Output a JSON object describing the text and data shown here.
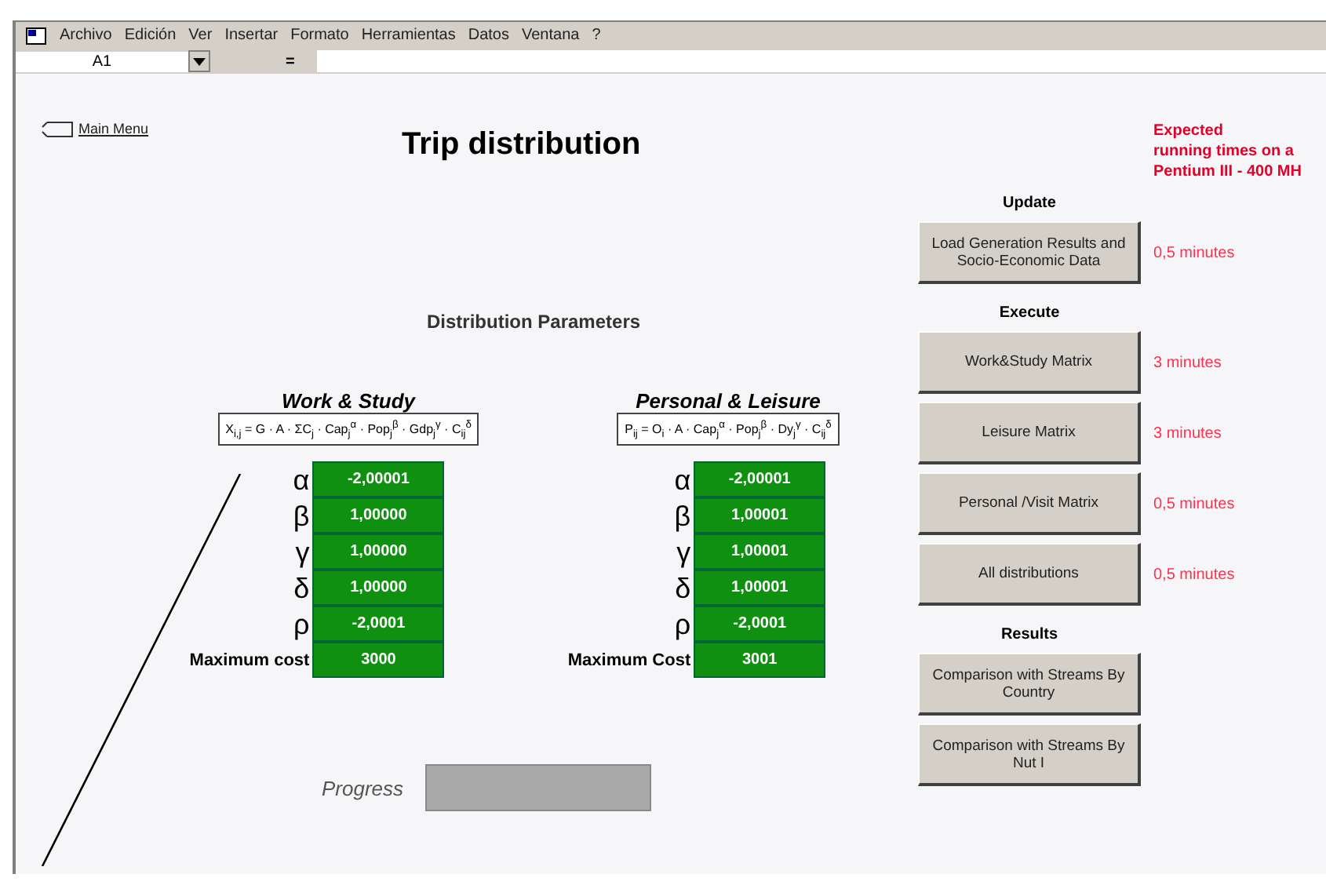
{
  "menu_bar": {
    "items": [
      "Archivo",
      "Edición",
      "Ver",
      "Insertar",
      "Formato",
      "Herramientas",
      "Datos",
      "Ventana",
      "?"
    ]
  },
  "formula_bar": {
    "cell_reference": "A1",
    "equals": "="
  },
  "main_menu_link": "Main Menu",
  "title": "Trip distribution",
  "parameters_heading": "Distribution Parameters",
  "parameter_sets": [
    {
      "title": "Work & Study",
      "formula": "X$_{i,j}$ = G · A · ΣC$_{j}$ · Cap$_{j}$$^{α}$ · Pop$_{j}$$^{β}$ · Gdp$_{j}$$^{γ}$ · C$_{ij}$$^{δ}$",
      "rows": [
        {
          "label": "α",
          "value": "-2,00001",
          "kind": "greek"
        },
        {
          "label": "β",
          "value": "1,00000",
          "kind": "greek"
        },
        {
          "label": "γ",
          "value": "1,00000",
          "kind": "greek"
        },
        {
          "label": "δ",
          "value": "1,00000",
          "kind": "greek"
        },
        {
          "label": "ρ",
          "value": "-2,0001",
          "kind": "greek"
        },
        {
          "label": "Maximum cost",
          "value": "3000",
          "kind": "text"
        }
      ]
    },
    {
      "title": "Personal & Leisure",
      "formula": "P$_{ij}$ = O$_{i}$ · A · Cap$_{j}$$^{α}$ · Pop$_{j}$$^{β}$ · Dy$_{j}$$^{γ}$ · C$_{ij}$$^{δ}$",
      "rows": [
        {
          "label": "α",
          "value": "-2,00001",
          "kind": "greek"
        },
        {
          "label": "β",
          "value": "1,00001",
          "kind": "greek"
        },
        {
          "label": "γ",
          "value": "1,00001",
          "kind": "greek"
        },
        {
          "label": "δ",
          "value": "1,00001",
          "kind": "greek"
        },
        {
          "label": "ρ",
          "value": "-2,0001",
          "kind": "greek"
        },
        {
          "label": "Maximum Cost",
          "value": "3001",
          "kind": "text"
        }
      ]
    }
  ],
  "progress": {
    "label": "Progress"
  },
  "expected_note": [
    "Expected",
    "running times on a",
    "Pentium III - 400 MH"
  ],
  "sections": [
    {
      "heading": "Update",
      "buttons": [
        {
          "label": "Load Generation Results and Socio-Economic Data",
          "time": "0,5 minutes"
        }
      ]
    },
    {
      "heading": "Execute",
      "buttons": [
        {
          "label": "Work&Study Matrix",
          "time": "3 minutes"
        },
        {
          "label": "Leisure Matrix",
          "time": "3 minutes"
        },
        {
          "label": "Personal /Visit Matrix",
          "time": "0,5 minutes"
        },
        {
          "label": "All distributions",
          "time": "0,5 minutes"
        }
      ]
    },
    {
      "heading": "Results",
      "buttons": [
        {
          "label": "Comparison with Streams By Country"
        },
        {
          "label": "Comparison with Streams By Nut I"
        }
      ]
    }
  ]
}
